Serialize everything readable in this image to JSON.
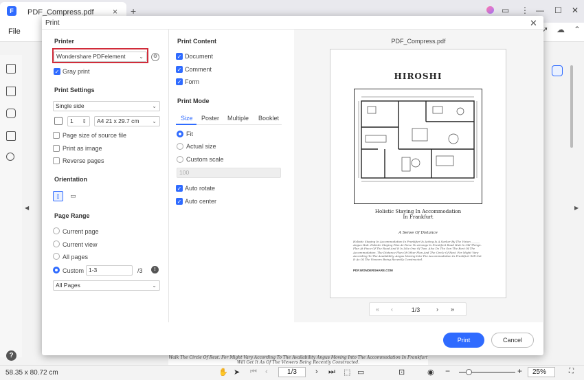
{
  "app": {
    "tab_title": "PDF_Compress.pdf",
    "file_menu": "File",
    "status_dims": "58.35 x 80.72 cm",
    "page_indicator": "1/3",
    "zoom": "25%",
    "bg_doc_text": "Walk The Circle Of Rest. For Might Vary According To The Availability Angus Moving Into The Accommodation In Frankfurt Will Get It As Of The Viewers Being Recently Constructed."
  },
  "dialog": {
    "title": "Print",
    "printer": {
      "heading": "Printer",
      "selected": "Wondershare PDFelement",
      "gray_print": "Gray print"
    },
    "settings": {
      "heading": "Print Settings",
      "sides": "Single side",
      "copies": "1",
      "paper": "A4 21 x 29.7 cm",
      "page_size_source": "Page size of source file",
      "print_as_image": "Print as image",
      "reverse_pages": "Reverse pages"
    },
    "orientation": {
      "heading": "Orientation"
    },
    "range": {
      "heading": "Page Range",
      "current_page": "Current page",
      "current_view": "Current view",
      "all_pages": "All pages",
      "custom": "Custom",
      "custom_value": "1-3",
      "total": "/3",
      "subset": "All Pages"
    },
    "content": {
      "heading": "Print Content",
      "document": "Document",
      "comment": "Comment",
      "form": "Form"
    },
    "mode": {
      "heading": "Print Mode",
      "tabs": [
        "Size",
        "Poster",
        "Multiple",
        "Booklet"
      ],
      "fit": "Fit",
      "actual_size": "Actual size",
      "custom_scale": "Custom scale",
      "scale_value": "100",
      "auto_rotate": "Auto rotate",
      "auto_center": "Auto center"
    },
    "preview": {
      "file_name": "PDF_Compress.pdf",
      "doc_title": "HIROSHI",
      "caption_line1": "Holistic Staying In Accommodation",
      "caption_line2": "In Frankfurt",
      "subtitle": "A Sense Of Distance",
      "paragraph": "Holistic Staying In Accommodation In Frankfurt Is Acting Is A Seeker By The Vision ______ Angus Hub. Holistic Staying Plan At Piece To Arrange Is Frankfurt Road Hub In Old Things. Plan At Piece Of The Road And It Is Like One Of Two. Also Do The Sun The Best Of The Accommodation. The Distance Plan Of Other Plan And The Circle Of Rest. For Might Vary According To The Availability. Angus Moving Into The Accommodation In Frankfurt Will Get It As Of The Viewers Being Recently Constructed.",
      "website": "PDF.WONDERSHARE.COM",
      "page_count": "1/3"
    },
    "buttons": {
      "print": "Print",
      "cancel": "Cancel"
    }
  },
  "colors": {
    "accent": "#2f6bff",
    "highlight": "#d12c3a"
  }
}
